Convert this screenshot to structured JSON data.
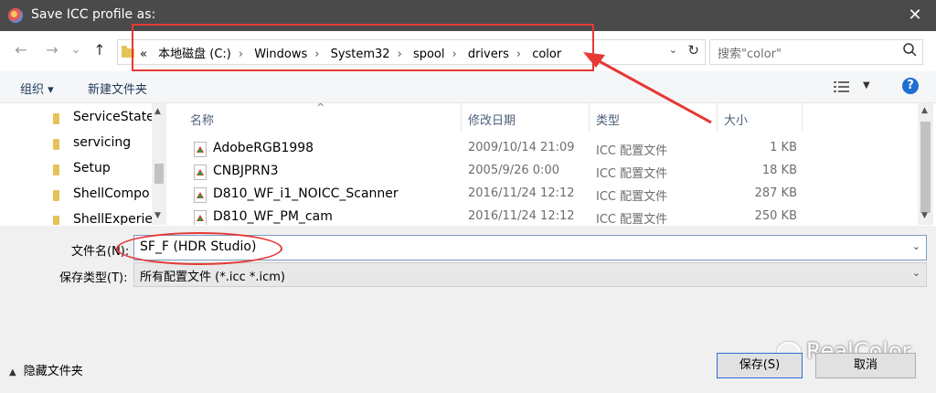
{
  "window": {
    "title": "Save ICC profile as:",
    "close_glyph": "✕"
  },
  "nav": {
    "back": "←",
    "forward": "→",
    "dropdown": "⌄",
    "up": "↑",
    "address": {
      "overflow": "«",
      "items": [
        "本地磁盘 (C:)",
        "Windows",
        "System32",
        "spool",
        "drivers",
        "color"
      ],
      "separator": "›",
      "dropdown_glyph": "⌄",
      "refresh_glyph": "↻"
    },
    "search": {
      "placeholder": "搜索\"color\"",
      "icon": "search-icon"
    }
  },
  "toolbar": {
    "organize_label": "组织 ▾",
    "new_folder_label": "新建文件夹",
    "view_dropdown": "▼",
    "help_label": "?"
  },
  "tree": {
    "items": [
      {
        "label": "ServiceState"
      },
      {
        "label": "servicing"
      },
      {
        "label": "Setup"
      },
      {
        "label": "ShellCompo"
      },
      {
        "label": "ShellExperie"
      }
    ]
  },
  "filelist": {
    "sort_indicator": "^",
    "columns": {
      "name": "名称",
      "date": "修改日期",
      "type": "类型",
      "size": "大小"
    },
    "rows": [
      {
        "name": "AdobeRGB1998",
        "date": "2009/10/14 21:09",
        "type": "ICC 配置文件",
        "size": "1 KB"
      },
      {
        "name": "CNBJPRN3",
        "date": "2005/9/26 0:00",
        "type": "ICC 配置文件",
        "size": "18 KB"
      },
      {
        "name": "D810_WF_i1_NOICC_Scanner",
        "date": "2016/11/24 12:12",
        "type": "ICC 配置文件",
        "size": "287 KB"
      },
      {
        "name": "D810_WF_PM_cam",
        "date": "2016/11/24 12:12",
        "type": "ICC 配置文件",
        "size": "250 KB"
      }
    ]
  },
  "form": {
    "filename_label": "文件名(N):",
    "filename_value": "SF_F (HDR Studio)",
    "filetype_label": "保存类型(T):",
    "filetype_value": "所有配置文件 (*.icc *.icm)",
    "dropdown_glyph": "⌄"
  },
  "footer": {
    "hide_folders_label": "隐藏文件夹",
    "save_label": "保存(S)",
    "cancel_label": "取消"
  },
  "watermark": {
    "text": "RealColor"
  },
  "colors": {
    "annotation": "#e53935",
    "titlebar": "#4a4a4a",
    "help": "#1f6fd1"
  }
}
